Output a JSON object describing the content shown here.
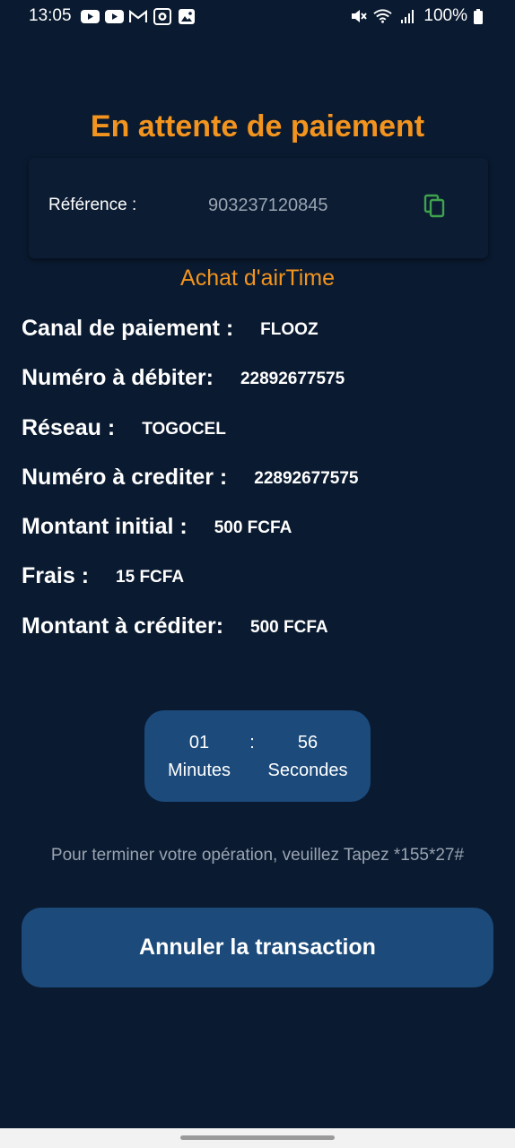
{
  "status_bar": {
    "time": "13:05",
    "left_icons": [
      "youtube-icon",
      "youtube-icon",
      "gmail-icon",
      "camera-icon",
      "gallery-icon"
    ],
    "right_icons": [
      "mute-icon",
      "wifi-icon",
      "signal-icon",
      "battery-icon"
    ],
    "battery": "100%"
  },
  "header": {
    "title": "En attente de paiement"
  },
  "reference": {
    "label": "Référence :",
    "value": "903237120845",
    "copy_icon": "copy-icon",
    "copy_color": "#3fa34d"
  },
  "subtitle": "Achat d'airTime",
  "details": [
    {
      "label": "Canal de paiement :",
      "value": "FLOOZ"
    },
    {
      "label": "Numéro à débiter:",
      "value": "22892677575"
    },
    {
      "label": "Réseau :",
      "value": "TOGOCEL"
    },
    {
      "label": "Numéro à crediter :",
      "value": "22892677575"
    },
    {
      "label": "Montant initial :",
      "value": "500 FCFA"
    },
    {
      "label": "Frais :",
      "value": "15 FCFA"
    },
    {
      "label": "Montant à créditer:",
      "value": "500 FCFA"
    }
  ],
  "timer": {
    "minutes": "01",
    "separator": ":",
    "seconds": "56",
    "minutes_label": "Minutes",
    "seconds_label": "Secondes"
  },
  "instruction": "Pour terminer votre opération, veuillez Tapez *155*27#",
  "cancel_button": "Annuler la transaction",
  "colors": {
    "background": "#0a1a30",
    "accent": "#f2941e",
    "button": "#1b4a7b"
  }
}
